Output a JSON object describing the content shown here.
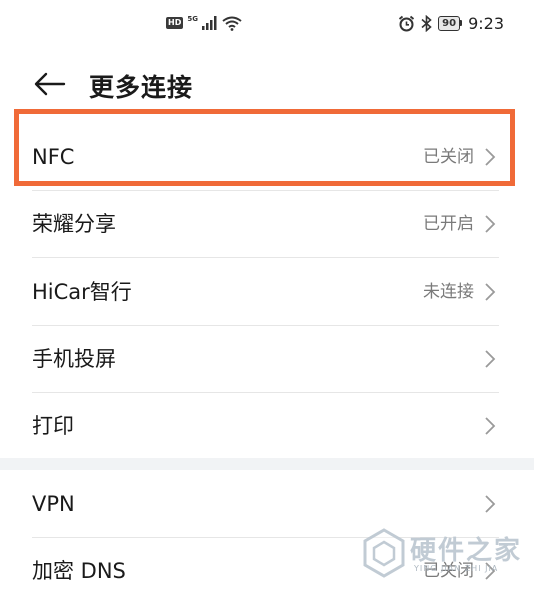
{
  "status_bar": {
    "hd": "HD",
    "network": "5G",
    "battery": "90",
    "time": "9:23"
  },
  "header": {
    "title": "更多连接"
  },
  "list": [
    {
      "label": "NFC",
      "status": "已关闭"
    },
    {
      "label": "荣耀分享",
      "status": "已开启"
    },
    {
      "label": "HiCar智行",
      "status": "未连接"
    },
    {
      "label": "手机投屏",
      "status": ""
    },
    {
      "label": "打印",
      "status": ""
    },
    {
      "label": "VPN",
      "status": ""
    },
    {
      "label": "加密 DNS",
      "status": "已关闭"
    }
  ],
  "watermark": {
    "text": "硬件之家",
    "sub": "YING JIAN ZHI JIA"
  },
  "colors": {
    "highlight": "#f06a38",
    "section_gap": "#f1f3f5"
  },
  "icons": [
    "back-arrow-icon",
    "signal-icon",
    "wifi-icon",
    "alarm-icon",
    "bluetooth-icon",
    "chevron-right-icon"
  ]
}
